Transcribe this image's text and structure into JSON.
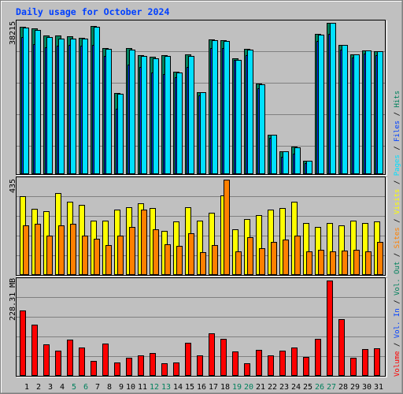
{
  "header": {
    "title": "Daily usage for October 2024"
  },
  "chart_data": [
    {
      "type": "bar",
      "title": "Daily usage for October 2024",
      "xlabel": "",
      "ylabel": "",
      "ymax_label": "38215",
      "ylim": [
        0,
        38215
      ],
      "grid": true,
      "categories": [
        "1",
        "2",
        "3",
        "4",
        "5",
        "6",
        "7",
        "8",
        "9",
        "10",
        "11",
        "12",
        "13",
        "14",
        "15",
        "16",
        "17",
        "18",
        "19",
        "20",
        "21",
        "22",
        "23",
        "24",
        "25",
        "26",
        "27",
        "28",
        "29",
        "30",
        "31"
      ],
      "series": [
        {
          "name": "Hits",
          "color": "#00805c",
          "values": [
            37215,
            36815,
            35014,
            35014,
            34814,
            34354,
            37355,
            31813,
            20548,
            31813,
            30012,
            29612,
            30012,
            25810,
            30212,
            20748,
            34014,
            33813,
            29212,
            31613,
            22809,
            10004,
            5802,
            7003,
            3401,
            35414,
            38215,
            32613,
            30212,
            31212,
            31012
          ]
        },
        {
          "name": "Files",
          "color": "#0040ff",
          "values": [
            34674,
            32813,
            32013,
            32353,
            32553,
            32353,
            32553,
            29812,
            16467,
            27672,
            27011,
            25670,
            25210,
            24550,
            27011,
            19808,
            31813,
            31813,
            28812,
            30012,
            21609,
            9204,
            4342,
            5202,
            2801,
            33614,
            35414,
            31413,
            29412,
            30412,
            30012
          ]
        },
        {
          "name": "Pages",
          "color": "#00e0ff",
          "values": [
            37015,
            36355,
            34554,
            34154,
            34154,
            34154,
            37155,
            31553,
            20208,
            31353,
            29812,
            29212,
            29812,
            25610,
            29812,
            20748,
            33813,
            33553,
            28952,
            31413,
            22609,
            9864,
            5802,
            6803,
            3401,
            35214,
            38215,
            32613,
            30212,
            31212,
            31012
          ]
        }
      ]
    },
    {
      "type": "bar",
      "title": "",
      "xlabel": "",
      "ylabel": "",
      "ymax_label": "435",
      "ylim": [
        0,
        435
      ],
      "grid": true,
      "categories": [
        "1",
        "2",
        "3",
        "4",
        "5",
        "6",
        "7",
        "8",
        "9",
        "10",
        "11",
        "12",
        "13",
        "14",
        "15",
        "16",
        "17",
        "18",
        "19",
        "20",
        "21",
        "22",
        "23",
        "24",
        "25",
        "26",
        "27",
        "28",
        "29",
        "30",
        "31"
      ],
      "series": [
        {
          "name": "Visits",
          "color": "#ffff00",
          "values": [
            359,
            301,
            290,
            373,
            334,
            319,
            247,
            247,
            297,
            308,
            326,
            305,
            203,
            243,
            308,
            247,
            283,
            363,
            207,
            254,
            272,
            297,
            305,
            334,
            239,
            221,
            239,
            225,
            247,
            239,
            243
          ]
        },
        {
          "name": "Sites",
          "color": "#ff8000",
          "values": [
            228,
            232,
            181,
            225,
            232,
            181,
            167,
            138,
            181,
            218,
            297,
            210,
            141,
            134,
            192,
            105,
            138,
            435,
            109,
            174,
            123,
            152,
            163,
            181,
            109,
            116,
            109,
            112,
            116,
            109,
            152
          ]
        }
      ]
    },
    {
      "type": "bar",
      "title": "",
      "xlabel": "",
      "ylabel": "",
      "ymax_label": "228.31 MB",
      "unit": "MB",
      "ylim": [
        0,
        228.31
      ],
      "grid": true,
      "categories": [
        "1",
        "2",
        "3",
        "4",
        "5",
        "6",
        "7",
        "8",
        "9",
        "10",
        "11",
        "12",
        "13",
        "14",
        "15",
        "16",
        "17",
        "18",
        "19",
        "20",
        "21",
        "22",
        "23",
        "24",
        "25",
        "26",
        "27",
        "28",
        "29",
        "30",
        "31"
      ],
      "series": [
        {
          "name": "Volume",
          "color": "#ff0000",
          "values": [
            157.2,
            122.8,
            75.1,
            59.9,
            86.6,
            67.5,
            35.1,
            77.1,
            31.3,
            42.7,
            48.4,
            54.2,
            29.4,
            31.3,
            79.0,
            48.4,
            101.9,
            88.5,
            58.0,
            29.4,
            61.8,
            48.4,
            59.9,
            67.5,
            44.6,
            88.5,
            228.31,
            136.2,
            42.7,
            63.7,
            65.6
          ]
        }
      ]
    }
  ],
  "x_axis": {
    "weekend_days": [
      "5",
      "6",
      "12",
      "13",
      "19",
      "20",
      "26",
      "27"
    ],
    "weekday_color": "#000000",
    "weekend_color": "#00805c"
  },
  "legend": {
    "placement": "right",
    "separator": " / ",
    "separator_color": "#000000",
    "items": [
      {
        "label": "Volume",
        "color": "#ff0000"
      },
      {
        "label": "Vol. In",
        "color": "#0040ff"
      },
      {
        "label": "Vol. Out",
        "color": "#00805c"
      },
      {
        "label": "Sites",
        "color": "#ff8000"
      },
      {
        "label": "Visits",
        "color": "#ffff00"
      },
      {
        "label": "Pages",
        "color": "#00e0ff"
      },
      {
        "label": "Files",
        "color": "#0040ff"
      },
      {
        "label": "Hits",
        "color": "#00805c"
      }
    ]
  },
  "colors": {
    "background": "#c0c0c0",
    "gridline": "#808080",
    "title": "#0040ff",
    "bar_outline": "#000000"
  }
}
